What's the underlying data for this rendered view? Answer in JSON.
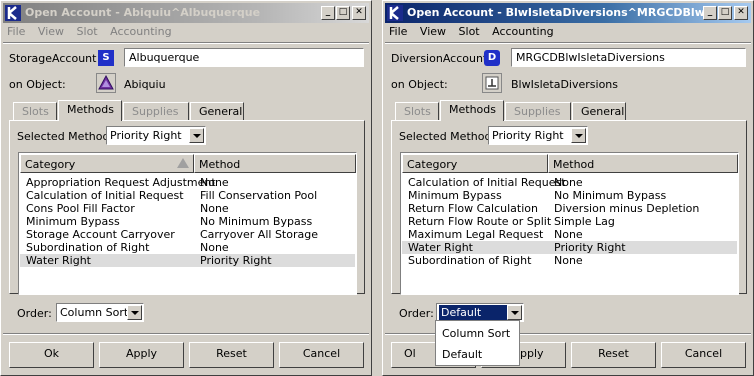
{
  "left": {
    "title": "Open Account - Abiquiu^Albuquerque",
    "menu": [
      "File",
      "View",
      "Slot",
      "Accounting"
    ],
    "account_label": "StorageAccount",
    "account_type_badge": "S",
    "account_value": "Albuquerque",
    "object_label": "on Object:",
    "object_name": "Abiquiu",
    "object_icon": "reservoir-triangle-icon",
    "tabs": [
      "Slots",
      "Methods",
      "Supplies",
      "General"
    ],
    "selected_method_label": "Selected Method:",
    "selected_method": "Priority Right",
    "columns": [
      "Category",
      "Method"
    ],
    "rows": [
      {
        "category": "Appropriation Request Adjustment",
        "method": "None"
      },
      {
        "category": "Calculation of Initial Request",
        "method": "Fill Conservation Pool"
      },
      {
        "category": "Cons Pool Fill Factor",
        "method": "None"
      },
      {
        "category": "Minimum Bypass",
        "method": "No Minimum Bypass"
      },
      {
        "category": "Storage Account Carryover",
        "method": "Carryover All Storage"
      },
      {
        "category": "Subordination of Right",
        "method": "None"
      },
      {
        "category": "Water Right",
        "method": "Priority Right"
      }
    ],
    "selected_row": 6,
    "order_label": "Order:",
    "order_value": "Column Sort",
    "buttons": [
      "Ok",
      "Apply",
      "Reset",
      "Cancel"
    ]
  },
  "right": {
    "title": "Open Account - BlwIsletaDiversions^MRGCDBlwIs...",
    "menu": [
      "File",
      "View",
      "Slot",
      "Accounting"
    ],
    "account_label": "DiversionAccount",
    "account_type_badge": "D",
    "account_value": "MRGCDBlwIsletaDiversions",
    "object_label": "on Object:",
    "object_name": "BlwIsletaDiversions",
    "object_icon": "diversion-object-icon",
    "tabs": [
      "Slots",
      "Methods",
      "Supplies",
      "General"
    ],
    "selected_method_label": "Selected Method:",
    "selected_method": "Priority Right",
    "columns": [
      "Category",
      "Method"
    ],
    "rows": [
      {
        "category": "Calculation of Initial Request",
        "method": "None"
      },
      {
        "category": "Minimum Bypass",
        "method": "No Minimum Bypass"
      },
      {
        "category": "Return Flow Calculation",
        "method": "Diversion minus Depletion"
      },
      {
        "category": "Return Flow Route or Split",
        "method": "Simple Lag"
      },
      {
        "category": "Maximum Legal Request",
        "method": "None"
      },
      {
        "category": "Water Right",
        "method": "Priority Right"
      },
      {
        "category": "Subordination of Right",
        "method": "None"
      }
    ],
    "selected_row": 5,
    "order_label": "Order:",
    "order_value": "Default",
    "order_options": [
      "Column Sort",
      "Default"
    ],
    "buttons": [
      "Ok",
      "Apply",
      "Reset",
      "Cancel"
    ],
    "buttons_visible": [
      "Ol",
      "pply",
      "Reset",
      "Cancel"
    ]
  },
  "colors": {
    "title_active": "#0a246a",
    "title_inactive": "#808080",
    "type_badge": "#2030c8"
  }
}
